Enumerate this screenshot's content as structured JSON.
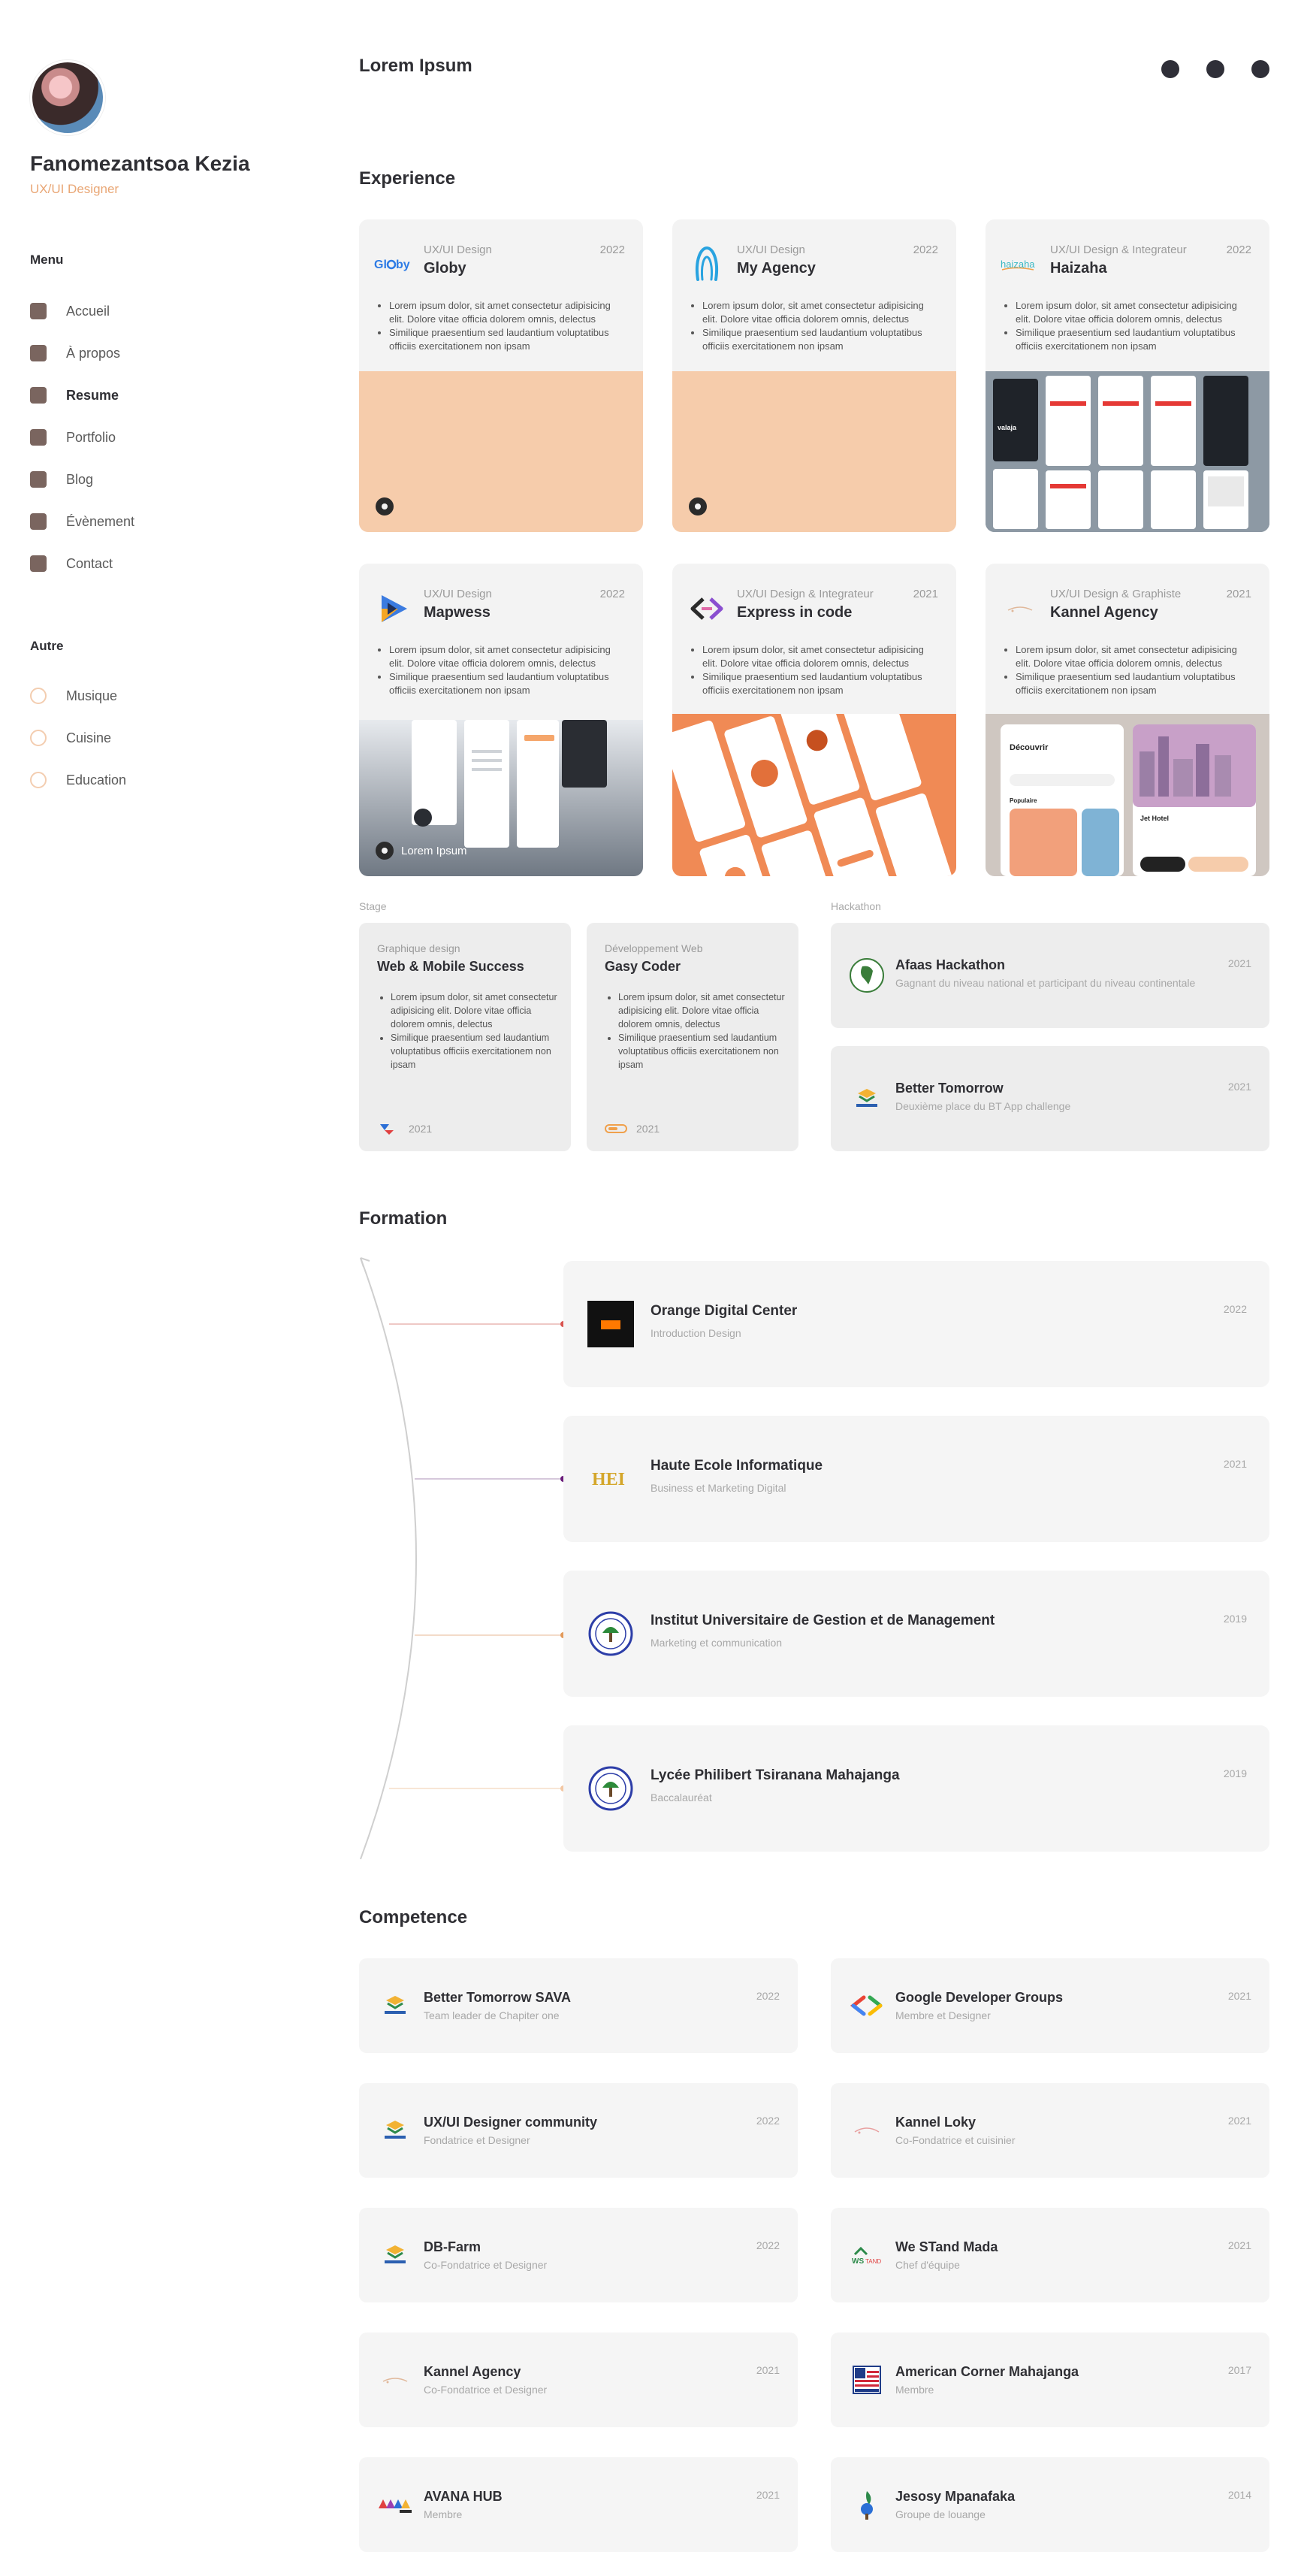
{
  "profile": {
    "name": "Fanomezantsoa Kezia",
    "role": "UX/UI Designer"
  },
  "menu": {
    "heading": "Menu",
    "items": [
      {
        "label": "Accueil"
      },
      {
        "label": "À propos"
      },
      {
        "label": "Resume",
        "active": true
      },
      {
        "label": "Portfolio"
      },
      {
        "label": "Blog"
      },
      {
        "label": "Évènement"
      },
      {
        "label": "Contact"
      }
    ]
  },
  "other": {
    "heading": "Autre",
    "items": [
      {
        "label": "Musique"
      },
      {
        "label": "Cuisine"
      },
      {
        "label": "Education"
      }
    ]
  },
  "header": {
    "title": "Lorem Ipsum"
  },
  "experience": {
    "title": "Experience",
    "bullet1": "Lorem ipsum dolor, sit amet consectetur adipisicing elit. Dolore vitae officia dolorem omnis, delectus",
    "bullet2": "Similique praesentium sed laudantium voluptatibus officiis exercitationem non ipsam",
    "cards": [
      {
        "category": "UX/UI Design",
        "title": "Globy",
        "year": "2022",
        "logo": "globy-logo"
      },
      {
        "category": "UX/UI Design",
        "title": "My Agency",
        "year": "2022",
        "logo": "my-agency-logo"
      },
      {
        "category": "UX/UI Design & Integrateur",
        "title": "Haizaha",
        "year": "2022",
        "logo": "haizaha-logo"
      },
      {
        "category": "UX/UI Design",
        "title": "Mapwess",
        "year": "2022",
        "logo": "mapwess-logo",
        "caption": "Lorem Ipsum"
      },
      {
        "category": "UX/UI Design & Integrateur",
        "title": "Express in code",
        "year": "2021",
        "logo": "express-in-code-logo"
      },
      {
        "category": "UX/UI Design & Graphiste",
        "title": "Kannel Agency",
        "year": "2021",
        "logo": "kannel-agency-logo"
      }
    ]
  },
  "stage": {
    "label": "Stage",
    "cards": [
      {
        "category": "Graphique design",
        "title": "Web & Mobile Success",
        "year": "2021"
      },
      {
        "category": "Développement Web",
        "title": "Gasy Coder",
        "year": "2021"
      }
    ]
  },
  "hackathon": {
    "label": "Hackathon",
    "cards": [
      {
        "title": "Afaas Hackathon",
        "subtitle": "Gagnant du niveau national et participant du niveau continentale",
        "year": "2021"
      },
      {
        "title": "Better Tomorrow",
        "subtitle": "Deuxième place du BT App challenge",
        "year": "2021"
      }
    ]
  },
  "formation": {
    "title": "Formation",
    "items": [
      {
        "title": "Orange Digital Center",
        "subtitle": "Introduction Design",
        "year": "2022",
        "dot_color": "#d9534f"
      },
      {
        "title": "Haute Ecole Informatique",
        "subtitle": "Business et Marketing Digital",
        "year": "2021",
        "dot_color": "#6a1b7a"
      },
      {
        "title": "Institut Universitaire de Gestion et de Management",
        "subtitle": "Marketing et communication",
        "year": "2019",
        "dot_color": "#e39a5a"
      },
      {
        "title": "Lycée Philibert Tsiranana Mahajanga",
        "subtitle": "Baccalauréat",
        "year": "2019",
        "dot_color": "#f3c7a3"
      }
    ]
  },
  "competence": {
    "title": "Competence",
    "items": [
      {
        "title": "Better Tomorrow SAVA",
        "subtitle": "Team leader de Chapiter one",
        "year": "2022"
      },
      {
        "title": "Google Developer Groups",
        "subtitle": "Membre et Designer",
        "year": "2021"
      },
      {
        "title": "UX/UI Designer community",
        "subtitle": "Fondatrice et Designer",
        "year": "2022"
      },
      {
        "title": "Kannel Loky",
        "subtitle": "Co-Fondatrice et cuisinier",
        "year": "2021"
      },
      {
        "title": "DB-Farm",
        "subtitle": "Co-Fondatrice et Designer",
        "year": "2022"
      },
      {
        "title": "We STand Mada",
        "subtitle": "Chef d'équipe",
        "year": "2021"
      },
      {
        "title": "Kannel Agency",
        "subtitle": "Co-Fondatrice et Designer",
        "year": "2021"
      },
      {
        "title": "American Corner Mahajanga",
        "subtitle": "Membre",
        "year": "2017"
      },
      {
        "title": "AVANA HUB",
        "subtitle": "Membre",
        "year": "2021"
      },
      {
        "title": "Jesosy Mpanafaka",
        "subtitle": "Groupe de louange",
        "year": "2014"
      }
    ]
  },
  "colors": {
    "accent_peach": "#f6ccab",
    "menu_square": "#7a655f",
    "role_text": "#e9a776"
  }
}
